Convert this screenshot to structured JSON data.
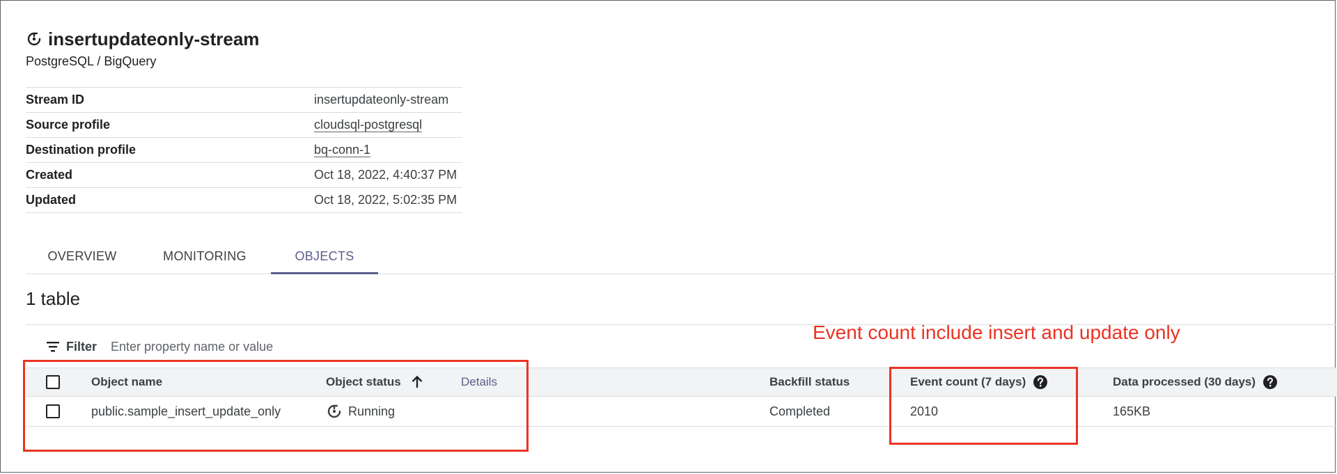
{
  "header": {
    "title": "insertupdateonly-stream",
    "subtitle": "PostgreSQL / BigQuery",
    "title_icon": "sync-icon"
  },
  "properties": [
    {
      "label": "Stream ID",
      "value": "insertupdateonly-stream",
      "link": false
    },
    {
      "label": "Source profile",
      "value": "cloudsql-postgresql",
      "link": true
    },
    {
      "label": "Destination profile",
      "value": "bq-conn-1",
      "link": true
    },
    {
      "label": "Created",
      "value": "Oct 18, 2022, 4:40:37 PM",
      "link": false
    },
    {
      "label": "Updated",
      "value": "Oct 18, 2022, 5:02:35 PM",
      "link": false
    }
  ],
  "tabs": [
    {
      "label": "OVERVIEW",
      "active": false
    },
    {
      "label": "MONITORING",
      "active": false
    },
    {
      "label": "OBJECTS",
      "active": true
    }
  ],
  "objects": {
    "count_label": "1 table",
    "filter": {
      "label": "Filter",
      "placeholder": "Enter property name or value"
    },
    "columns": {
      "object_name": "Object name",
      "object_status": "Object status",
      "details": "Details",
      "backfill_status": "Backfill status",
      "event_count": "Event count (7 days)",
      "data_processed": "Data processed (30 days)"
    },
    "rows": [
      {
        "object_name": "public.sample_insert_update_only",
        "object_status": "Running",
        "backfill_status": "Completed",
        "event_count": "2010",
        "data_processed": "165KB"
      }
    ]
  },
  "annotation": {
    "text": "Event count include insert and update only",
    "color": "#ea3323"
  },
  "colors": {
    "accent": "#5c5d8c",
    "text": "#202124",
    "border": "#dadce0",
    "header_bg": "#f1f3f4"
  }
}
